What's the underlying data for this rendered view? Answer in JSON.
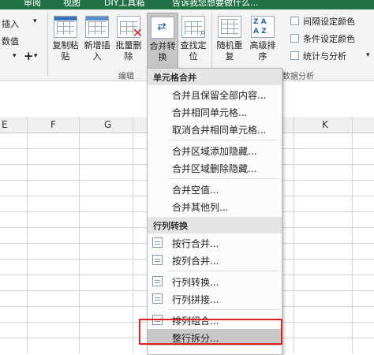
{
  "tabs": [
    "审阅",
    "视图",
    "DIY工具箱",
    "告诉我您想要做什么..."
  ],
  "clipboard": {
    "insert": "插入",
    "fill_value": "数值",
    "plus": "+"
  },
  "ribbon": {
    "buttons": [
      {
        "label1": "复制粘",
        "label2": "贴"
      },
      {
        "label1": "新增插",
        "label2": "入"
      },
      {
        "label1": "批量删",
        "label2": "除"
      },
      {
        "label1": "合并转",
        "label2": "换"
      },
      {
        "label1": "查找定",
        "label2": "位"
      },
      {
        "label1": "随机重",
        "label2": "复"
      },
      {
        "label1": "高级排",
        "label2": "序"
      }
    ],
    "small_items": [
      "间隔设定颜色",
      "条件设定颜色",
      "统计与分析"
    ],
    "group_labels": [
      "编辑",
      "数据分析"
    ]
  },
  "grid": {
    "columns": [
      "E",
      "F",
      "G",
      "K"
    ]
  },
  "menu": {
    "sections": [
      {
        "header": "单元格合并",
        "items": [
          "合并且保留全部内容...",
          "合并相同单元格...",
          "取消合并相同单元格...",
          "合并区域添加隐藏...",
          "合并区域删除隐藏...",
          "合并空值...",
          "合并其他列..."
        ]
      },
      {
        "header": "行列转换",
        "items": [
          "按行合并...",
          "按列合并...",
          "行列转换...",
          "行列拼接...",
          "排列组合...",
          "整行拆分..."
        ]
      }
    ]
  },
  "colors": {
    "accent": "#217346",
    "highlight": "#c8c8c8",
    "callout": "#e02020"
  }
}
